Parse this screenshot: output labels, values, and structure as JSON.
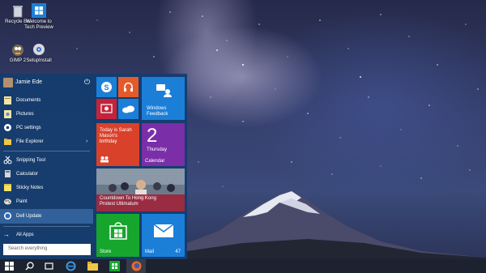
{
  "desktop": {
    "icons": [
      {
        "label_line1": "Recycle Bin",
        "label_line2": "",
        "icon": "recycle-bin-icon"
      },
      {
        "label_line1": "Welcome to",
        "label_line2": "Tech Preview",
        "icon": "windows-logo-icon"
      },
      {
        "label_line1": "GIMP 2",
        "label_line2": "",
        "icon": "gimp-icon"
      },
      {
        "label_line1": "SetupInstall",
        "label_line2": "",
        "icon": "installer-icon"
      }
    ]
  },
  "start_menu": {
    "user_name": "Jamie Ede",
    "items": [
      {
        "label": "Documents",
        "icon": "documents-icon",
        "arrow": ""
      },
      {
        "label": "Pictures",
        "icon": "pictures-icon",
        "arrow": ""
      },
      {
        "label": "PC settings",
        "icon": "gear-icon",
        "arrow": ""
      },
      {
        "label": "File Explorer",
        "icon": "folder-icon",
        "arrow": "›"
      },
      {
        "label": "Snipping Tool",
        "icon": "scissors-icon",
        "arrow": ""
      },
      {
        "label": "Calculator",
        "icon": "calculator-icon",
        "arrow": ""
      },
      {
        "label": "Sticky Notes",
        "icon": "sticky-notes-icon",
        "arrow": ""
      },
      {
        "label": "Paint",
        "icon": "paint-icon",
        "arrow": ""
      },
      {
        "label": "Dell Update",
        "icon": "dell-icon",
        "arrow": ""
      }
    ],
    "all_apps_label": "All Apps",
    "all_apps_arrow": "→",
    "search_placeholder": "Search everything"
  },
  "tiles": {
    "feedback_label_line1": "Windows",
    "feedback_label_line2": "Feedback",
    "people_text_line1": "Today is Sarah",
    "people_text_line2": "Mason's",
    "people_text_line3": "birthday",
    "calendar_day_number": "2",
    "calendar_day_name": "Thursday",
    "calendar_label": "Calendar",
    "news_headline_line1": "Countdown To Hong Kong",
    "news_headline_line2": "Protest Ultimatum",
    "store_label": "Store",
    "mail_label": "Mail",
    "mail_count": "47"
  },
  "colors": {
    "tile_blue": "#1b7fd8",
    "tile_dark_blue": "#1565b8",
    "tile_red": "#d9412b",
    "tile_orange": "#e55a2b",
    "tile_purple": "#7a2ea8",
    "tile_green": "#16a62e",
    "start_bg": "#143c6e"
  }
}
